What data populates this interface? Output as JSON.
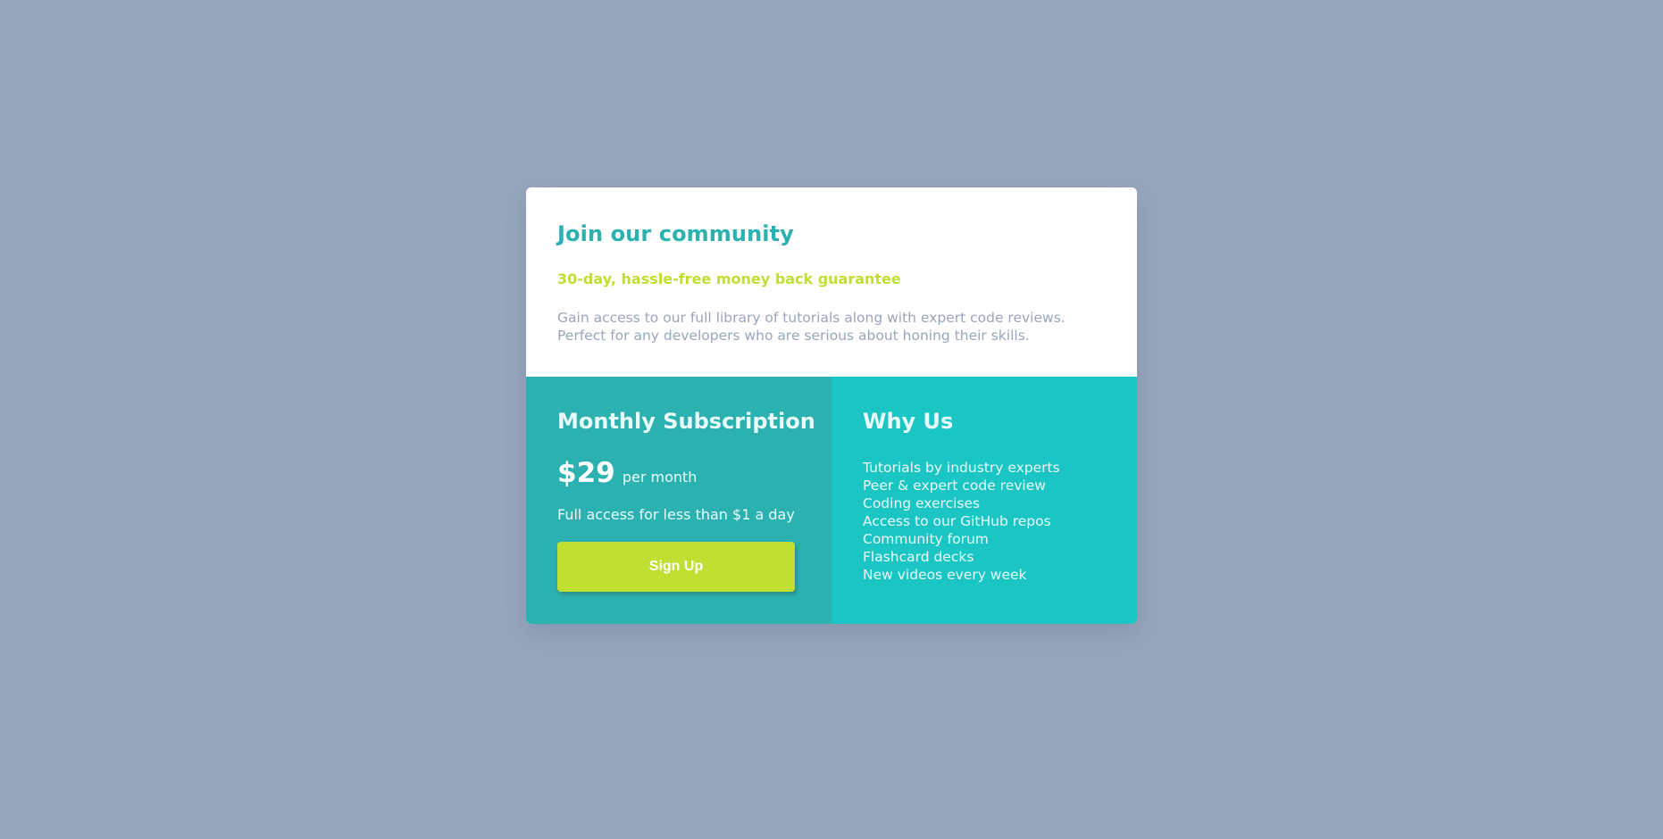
{
  "header": {
    "title": "Join our community",
    "guarantee": "30-day, hassle-free money back guarantee",
    "description": "Gain access to our full library of tutorials along with expert code reviews. Perfect for any developers who are serious about honing their skills."
  },
  "subscription": {
    "title": "Monthly Subscription",
    "price": "$29",
    "period": "per month",
    "note": "Full access for less than $1 a day",
    "cta_label": "Sign Up"
  },
  "why_us": {
    "title": "Why Us",
    "features": [
      "Tutorials by industry experts",
      "Peer & expert code review",
      "Coding exercises",
      "Access to our GitHub repos",
      "Community forum",
      "Flashcard decks",
      "New videos every week"
    ]
  },
  "colors": {
    "background": "#97a6bd",
    "primary_teal": "#2bb2b0",
    "secondary_teal": "#1ac5c4",
    "accent_lime": "#bfdf32",
    "muted_text": "#9aa5bd"
  }
}
